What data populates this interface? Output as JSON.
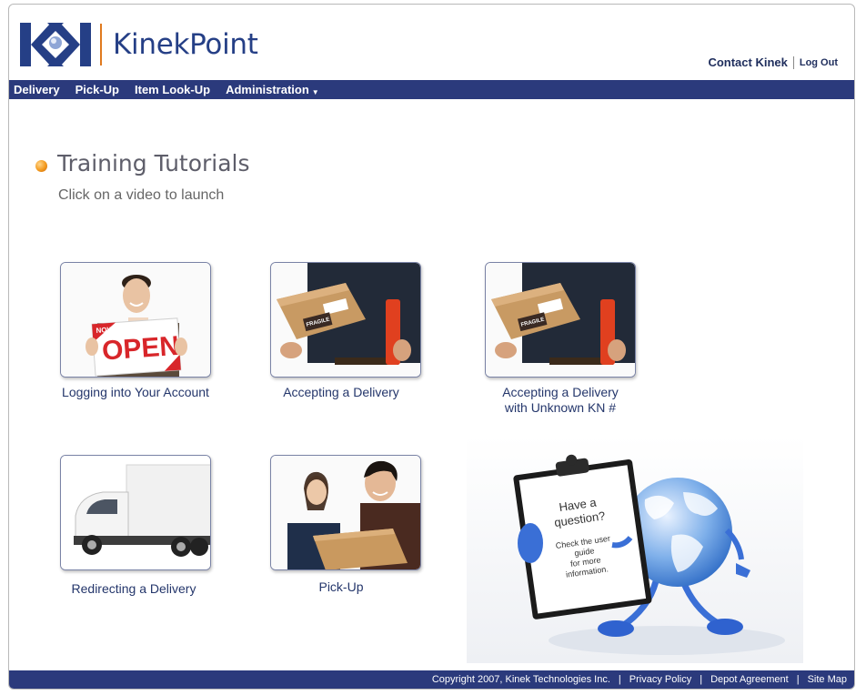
{
  "brand": {
    "name": "KinekPoint",
    "accent": "#253f86",
    "orange": "#e07a1f"
  },
  "header": {
    "contact_label": "Contact Kinek",
    "logout_label": "Log Out"
  },
  "nav": {
    "delivery": "Delivery",
    "pickup": "Pick-Up",
    "lookup": "Item Look-Up",
    "admin": "Administration"
  },
  "main": {
    "title": "Training Tutorials",
    "subtitle": "Click on a video to launch",
    "videos": [
      {
        "caption": "Logging into Your Account",
        "sign_top": "NOW",
        "sign_main": "OPEN"
      },
      {
        "caption": "Accepting a Delivery",
        "label": "FRAGILE"
      },
      {
        "caption_line1": "Accepting a Delivery",
        "caption_line2": "with Unknown KN #",
        "label": "FRAGILE"
      },
      {
        "caption": "Redirecting a Delivery"
      },
      {
        "caption": "Pick-Up"
      }
    ],
    "help": {
      "line1": "Have a",
      "line2": "question?",
      "line3": "Check the user",
      "line4": "guide",
      "line5": "for more",
      "line6": "information."
    }
  },
  "footer": {
    "copyright": "Copyright 2007, Kinek Technologies Inc.",
    "privacy": "Privacy Policy",
    "depot": "Depot Agreement",
    "sitemap": "Site Map",
    "separator": "|"
  }
}
